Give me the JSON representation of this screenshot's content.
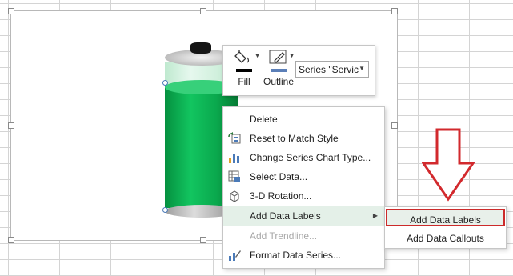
{
  "toolbar": {
    "fill_label": "Fill",
    "outline_label": "Outline",
    "series_select_value": "Series \"Service"
  },
  "context_menu": {
    "items": [
      {
        "label": "Delete",
        "icon": "none"
      },
      {
        "label": "Reset to Match Style",
        "icon": "reset-style-icon"
      },
      {
        "label": "Change Series Chart Type...",
        "icon": "chart-type-icon"
      },
      {
        "label": "Select Data...",
        "icon": "select-data-icon"
      },
      {
        "label": "3-D Rotation...",
        "icon": "cube-icon"
      },
      {
        "label": "Add Data Labels",
        "icon": "none",
        "has_submenu": true
      },
      {
        "label": "Add Trendline...",
        "icon": "none",
        "disabled": true
      },
      {
        "label": "Format Data Series...",
        "icon": "format-series-icon"
      }
    ]
  },
  "submenu": {
    "items": [
      {
        "label": "Add Data Labels",
        "highlighted": true
      },
      {
        "label": "Add Data Callouts"
      }
    ]
  },
  "colors": {
    "battery_fill": "#12c560",
    "highlight_border": "#cc2a2a",
    "menu_hover": "#e4f0e8",
    "gridline": "#d4d4d4"
  }
}
